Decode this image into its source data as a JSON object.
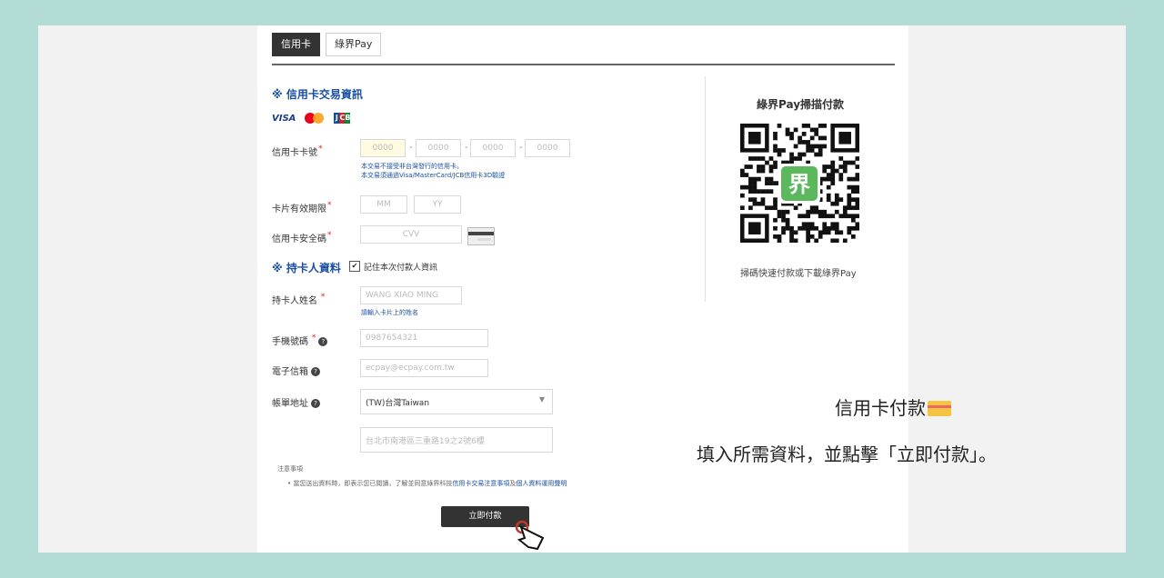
{
  "tabs": [
    "信用卡",
    "綠界Pay"
  ],
  "section_card": "※ 信用卡交易資訊",
  "card_brands": [
    "VISA",
    "MasterCard",
    "JCB"
  ],
  "labels": {
    "card_number": "信用卡卡號",
    "expiry": "卡片有效期限",
    "cvv": "信用卡安全碼",
    "name": "持卡人姓名",
    "phone": "手機號碼",
    "email": "電子信箱",
    "address": "帳單地址"
  },
  "placeholders": {
    "card_segment": "0000",
    "month": "MM",
    "year": "YY",
    "cvv": "CVV",
    "name": "WANG XIAO MING",
    "phone": "0987654321",
    "email": "ecpay@ecpay.com.tw",
    "address": "台北市南港區三重路19之2號6樓"
  },
  "card_notes": [
    "本交易不接受非台灣發行的信用卡。",
    "本交易須通過Visa/MasterCard/JCB信用卡3D驗證"
  ],
  "section_holder": "※ 持卡人資料",
  "remember_label": "記住本次付款人資訊",
  "name_note": "請輸入卡片上的姓名",
  "country_value": "(TW)台灣Taiwan",
  "notice_title": "注意事項",
  "notice_text": "當您送出資料時，即表示您已閱讀，了解並同意綠界科技",
  "notice_link1": "信用卡交易注意事項",
  "notice_and": "及",
  "notice_link2": "個人資料運用聲明",
  "pay_button": "立即付款",
  "qr": {
    "title": "綠界Pay掃描付款",
    "caption": "掃碼快速付款或下載綠界Pay",
    "logo_char": "界"
  },
  "overlay": {
    "line1": "信用卡付款",
    "line2": "填入所需資料，並點擊「立即付款」。"
  },
  "colors": {
    "background": "#b3dcd7",
    "accent_blue": "#1b4fa3",
    "required_red": "#d22222",
    "qr_green": "#5cb85c"
  }
}
